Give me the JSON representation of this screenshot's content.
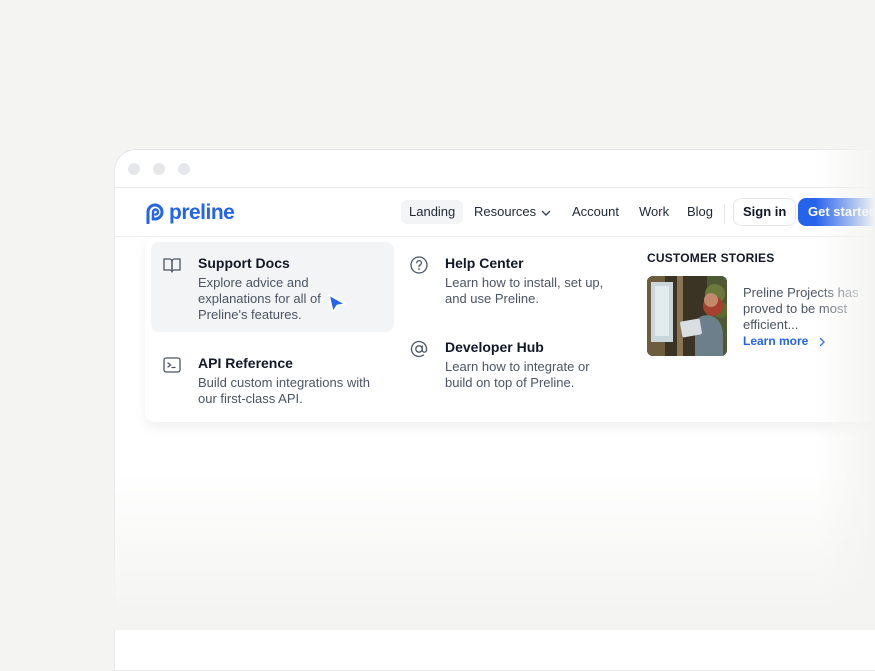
{
  "navbar": {
    "logo_text": "preline",
    "items": [
      {
        "label": "Landing"
      },
      {
        "label": "Resources"
      },
      {
        "label": "Account"
      },
      {
        "label": "Work"
      },
      {
        "label": "Blog"
      }
    ],
    "sign_in_label": "Sign in",
    "get_started_label": "Get started"
  },
  "menu": {
    "support_docs": {
      "title": "Support Docs",
      "description": "Explore advice and explanations for all of Preline's features.",
      "icon": "book-icon"
    },
    "api_reference": {
      "title": "API Reference",
      "description": "Build custom integrations with our first-class API.",
      "icon": "terminal-icon"
    },
    "help_center": {
      "title": "Help Center",
      "description": "Learn how to install, set up, and use Preline.",
      "icon": "help-circle-icon"
    },
    "developer_hub": {
      "title": "Developer Hub",
      "description": "Learn how to integrate or build on top of Preline.",
      "icon": "at-sign-icon"
    }
  },
  "customer_stories": {
    "heading": "CUSTOMER STORIES",
    "story_text": "Preline Projects has proved to be most efficient...",
    "learn_more_label": "Learn more"
  },
  "colors": {
    "accent": "#2563eb",
    "highlight_bg": "#f3f4f6"
  }
}
